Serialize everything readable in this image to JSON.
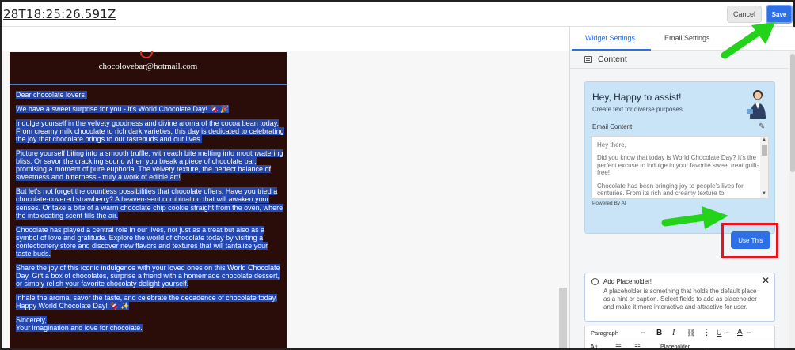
{
  "header": {
    "title": "28T18:25:26.591Z",
    "cancel_label": "Cancel",
    "save_label": "Save"
  },
  "email": {
    "from": "chocolovebar@hotmail.com",
    "paragraphs": [
      "Dear chocolate lovers,",
      "We have a sweet surprise for you - it's World Chocolate Day! 🍫 🎉",
      "Indulge yourself in the velvety goodness and divine aroma of the cocoa bean today. From creamy milk chocolate to rich dark varieties, this day is dedicated to celebrating the joy that chocolate brings to our tastebuds and our lives.",
      "Picture yourself biting into a smooth truffle, with each bite melting into mouthwatering bliss. Or savor the crackling sound when you break a piece of chocolate bar, promising a moment of pure euphoria. The velvety texture, the perfect balance of sweetness and bitterness - truly a work of edible art!",
      "But let's not forget the countless possibilities that chocolate offers. Have you tried a chocolate-covered strawberry? A heaven-sent combination that will awaken your senses. Or take a bite of a warm chocolate chip cookie straight from the oven, where the intoxicating scent fills the air.",
      "Chocolate has played a central role in our lives, not just as a treat but also as a symbol of love and gratitude. Explore the world of chocolate today by visiting a confectionery store and discover new flavors and textures that will tantalize your taste buds.",
      "Share the joy of this iconic indulgence with your loved ones on this World Chocolate Day. Gift a box of chocolates, surprise a friend with a homemade chocolate dessert, or simply relish your favorite chocolaty delight yourself.",
      "Inhale the aroma, savor the taste, and celebrate the decadence of chocolate today. Happy World Chocolate Day! 🍫 ✨",
      "Sincerely,\nYour imagination and love for chocolate."
    ]
  },
  "panel": {
    "tabs": {
      "widget": "Widget Settings",
      "email": "Email Settings"
    },
    "section_title": "Content",
    "ai": {
      "title": "Hey, Happy to assist!",
      "subtitle": "Create text for diverse purposes",
      "field_label": "Email Content",
      "preview": [
        "Hey there,",
        "Did you know that today is World Chocolate Day? It's the perfect excuse to indulge in your favorite sweet treat guilt-free!",
        "Chocolate has been bringing joy to people's lives for centuries. From its rich and creamy texture to"
      ],
      "powered_by": "Powered By AI",
      "cancel_label": "ncel",
      "use_this_label": "Use This"
    },
    "placeholder_box": {
      "title": "Add Placeholder!",
      "text": "A placeholder is something that holds the default place as a hint or caption. Select fields to add as placeholder and make it more interactive and attractive for user."
    },
    "editor": {
      "paragraph_label": "Paragraph",
      "placeholder_label": "Placeholder",
      "font_size_label": "A↕",
      "body_preview": "Dear chocolate lovers"
    }
  },
  "colors": {
    "primary": "#2d6fe7",
    "email_bg": "#2a0c08",
    "highlight": "#2448b0",
    "ai_card": "#c9e3f7",
    "annotation_red": "#e8131b",
    "annotation_green": "#22d31a"
  }
}
